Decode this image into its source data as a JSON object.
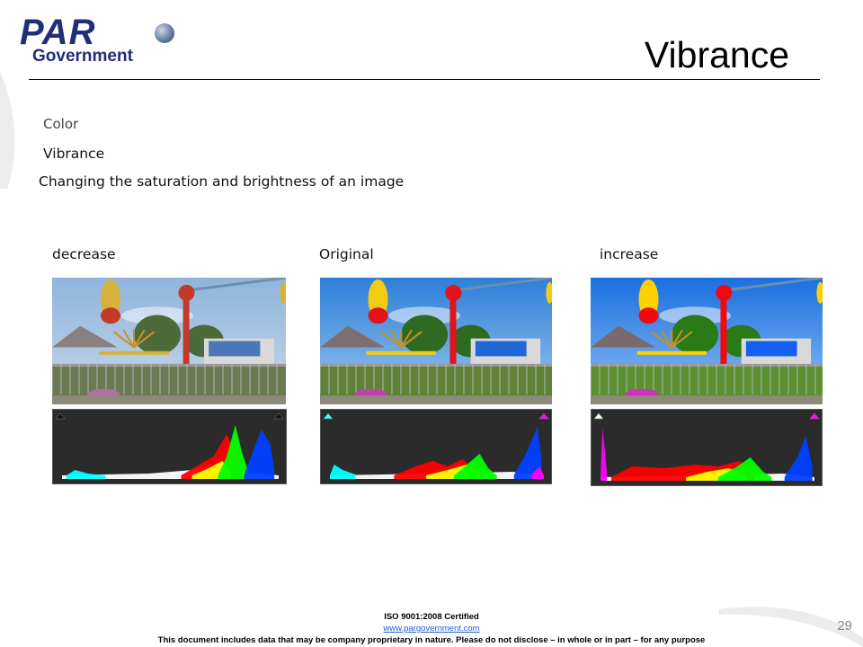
{
  "logo": {
    "brand": "PAR",
    "sub": "Government"
  },
  "slide": {
    "title": "Vibrance",
    "section": "Color",
    "subtitle": "Vibrance",
    "description": "Changing the saturation and brightness of an image"
  },
  "columns": [
    {
      "label": "decrease",
      "variant": "desaturated"
    },
    {
      "label": "Original",
      "variant": "normal"
    },
    {
      "label": "increase",
      "variant": "saturated"
    }
  ],
  "footer": {
    "iso": "ISO 9001:2008 Certified",
    "url": "www.pargovernment.com",
    "disclaimer": "This document includes data that may be company proprietary in nature. Please do not disclose – in whole or in part – for any purpose"
  },
  "page_number": "29",
  "colors": {
    "brand_blue": "#1f2f7a",
    "link_blue": "#1f5fd0",
    "histogram_bg": "#2b2b2b"
  }
}
